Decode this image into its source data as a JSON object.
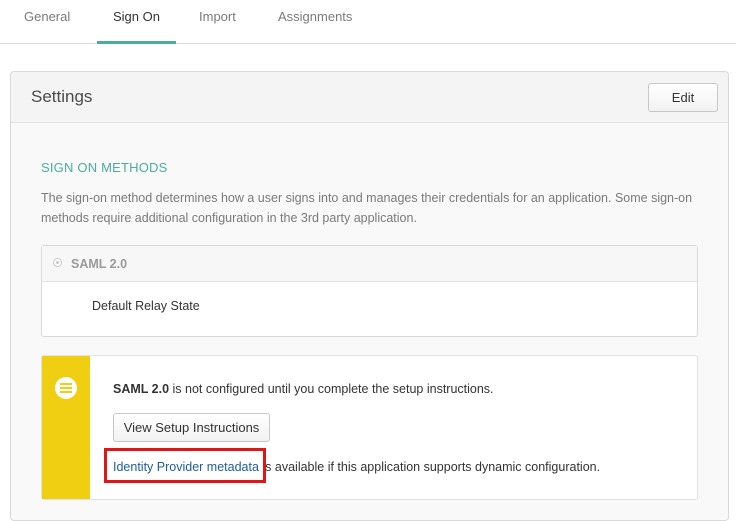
{
  "tabs": [
    {
      "label": "General",
      "active": false
    },
    {
      "label": "Sign On",
      "active": true
    },
    {
      "label": "Import",
      "active": false
    },
    {
      "label": "Assignments",
      "active": false
    }
  ],
  "panel": {
    "title": "Settings",
    "edit_label": "Edit"
  },
  "sign_on": {
    "section_title": "SIGN ON METHODS",
    "description": "The sign-on method determines how a user signs into and manages their credentials for an application. Some sign-on methods require additional configuration in the 3rd party application.",
    "method_label": "SAML 2.0",
    "relay_state_label": "Default Relay State"
  },
  "notice": {
    "icon": "list-icon",
    "method": "SAML 2.0",
    "text_rest": " is not configured until you complete the setup instructions.",
    "button_label": "View Setup Instructions",
    "metadata_link": "Identity Provider metadata",
    "metadata_rest": " is available if this application supports dynamic configuration."
  },
  "colors": {
    "accent": "#4aae9b",
    "notice_bar": "#f0cf13",
    "link": "#1f5e9d",
    "highlight": "#e01616"
  }
}
